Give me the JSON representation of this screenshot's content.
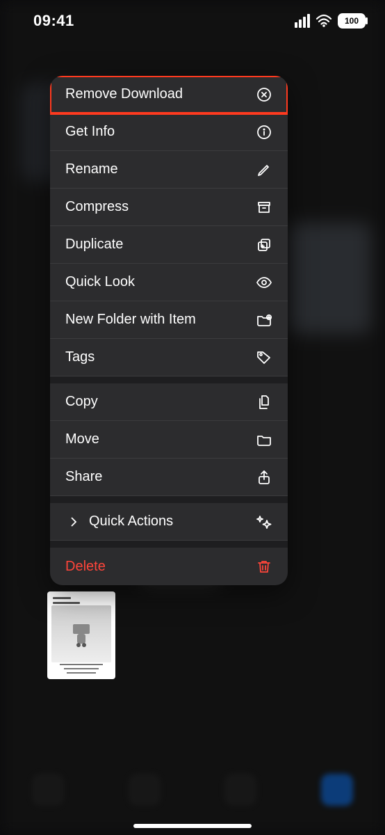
{
  "statusBar": {
    "time": "09:41",
    "batteryLabel": "100"
  },
  "menu": {
    "groups": [
      [
        {
          "key": "remove-download",
          "label": "Remove Download",
          "icon": "x-circle-icon",
          "highlighted": true
        },
        {
          "key": "get-info",
          "label": "Get Info",
          "icon": "info-circle-icon"
        },
        {
          "key": "rename",
          "label": "Rename",
          "icon": "pencil-icon"
        },
        {
          "key": "compress",
          "label": "Compress",
          "icon": "archivebox-icon"
        },
        {
          "key": "duplicate",
          "label": "Duplicate",
          "icon": "plus-square-on-square-icon"
        },
        {
          "key": "quick-look",
          "label": "Quick Look",
          "icon": "eye-icon"
        },
        {
          "key": "new-folder-with-item",
          "label": "New Folder with Item",
          "icon": "folder-plus-icon"
        },
        {
          "key": "tags",
          "label": "Tags",
          "icon": "tag-icon"
        }
      ],
      [
        {
          "key": "copy",
          "label": "Copy",
          "icon": "doc-on-doc-icon"
        },
        {
          "key": "move",
          "label": "Move",
          "icon": "folder-icon"
        },
        {
          "key": "share",
          "label": "Share",
          "icon": "share-icon"
        }
      ],
      [
        {
          "key": "quick-actions",
          "label": "Quick Actions",
          "icon": "sparkles-icon",
          "chevron": true
        }
      ],
      [
        {
          "key": "delete",
          "label": "Delete",
          "icon": "trash-icon",
          "danger": true
        }
      ]
    ]
  },
  "colors": {
    "highlight": "#ff3a1f",
    "danger": "#ff453a",
    "menuBg": "#2c2c2e"
  }
}
